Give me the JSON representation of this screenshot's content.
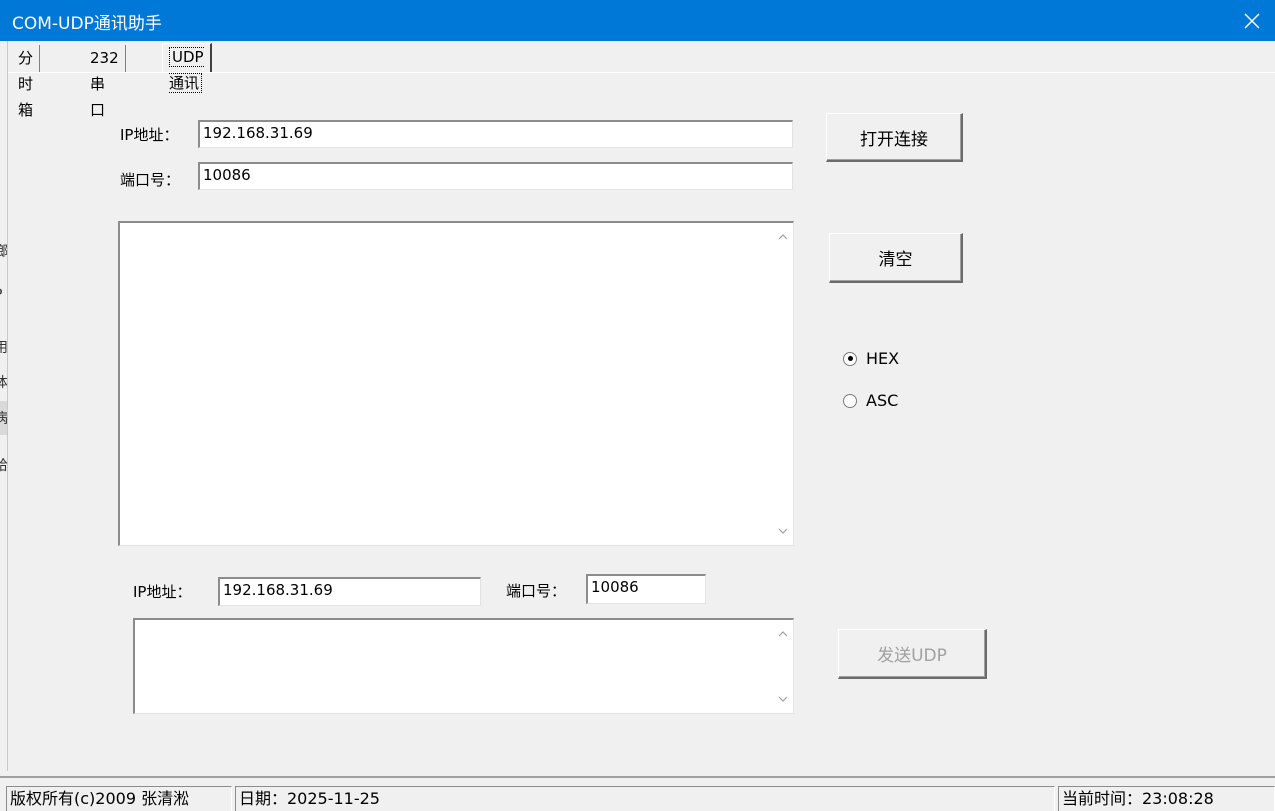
{
  "window": {
    "title": "COM-UDP通讯助手"
  },
  "tabs": [
    {
      "label": "分时箱"
    },
    {
      "label": "232串口"
    },
    {
      "label": "UDP通讯"
    }
  ],
  "side_fragments": [
    "鄉",
    "P",
    "用",
    "体",
    "病",
    "给"
  ],
  "connection": {
    "ip_label": "IP地址：",
    "ip_value": "192.168.31.69",
    "port_label": "端口号：",
    "port_value": "10086",
    "open_label": "打开连接"
  },
  "receive": {
    "text": "",
    "clear_label": "清空"
  },
  "mode": {
    "hex_label": "HEX",
    "asc_label": "ASC",
    "selected": "HEX"
  },
  "send": {
    "ip_label": "IP地址：",
    "ip_value": "192.168.31.69",
    "port_label": "端口号：",
    "port_value": "10086",
    "text": "",
    "send_label": "发送UDP"
  },
  "status": {
    "copyright": "版权所有(c)2009   张清淞",
    "date": "日期：2025-11-25",
    "time": "当前时间：23:08:28"
  },
  "icons": {
    "close": "close-icon",
    "scroll_up": "chevron-up-icon",
    "scroll_down": "chevron-down-icon",
    "radio_selected": "radio-checked-icon"
  }
}
